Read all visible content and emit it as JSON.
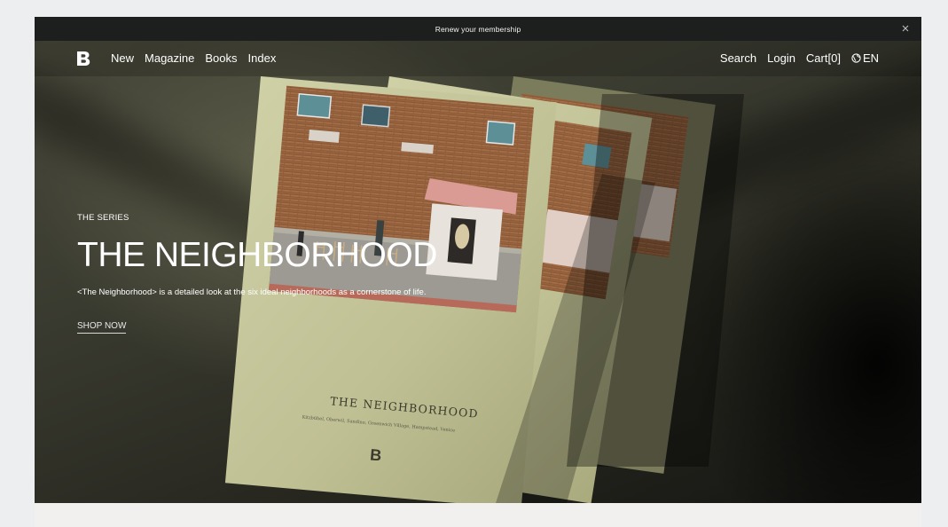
{
  "announcement": {
    "text": "Renew your membership",
    "close_icon": "close-icon"
  },
  "nav": {
    "logo": "B",
    "left_links": [
      "New",
      "Magazine",
      "Books",
      "Index"
    ],
    "search": "Search",
    "login": "Login",
    "cart": "Cart[0]",
    "language": "EN",
    "globe_icon": "globe-icon"
  },
  "hero": {
    "eyebrow": "THE SERIES",
    "title": "THE NEIGHBORHOOD",
    "description": "<The Neighborhood> is a detailed look at the six ideal neighborhoods as a cornerstone of life.",
    "cta": "SHOP NOW",
    "magazine_cover_title": "THE NEIGHBORHOOD",
    "magazine_cover_subtitle": "Kitzbühel, Oberwil, Sandino, Greenwich Village, Hampstead, Venice",
    "magazine_logo": "B"
  },
  "colors": {
    "announcement_bg": "#1d1f1e",
    "magazine_cover": "#c6c79d",
    "text": "#ffffff"
  }
}
